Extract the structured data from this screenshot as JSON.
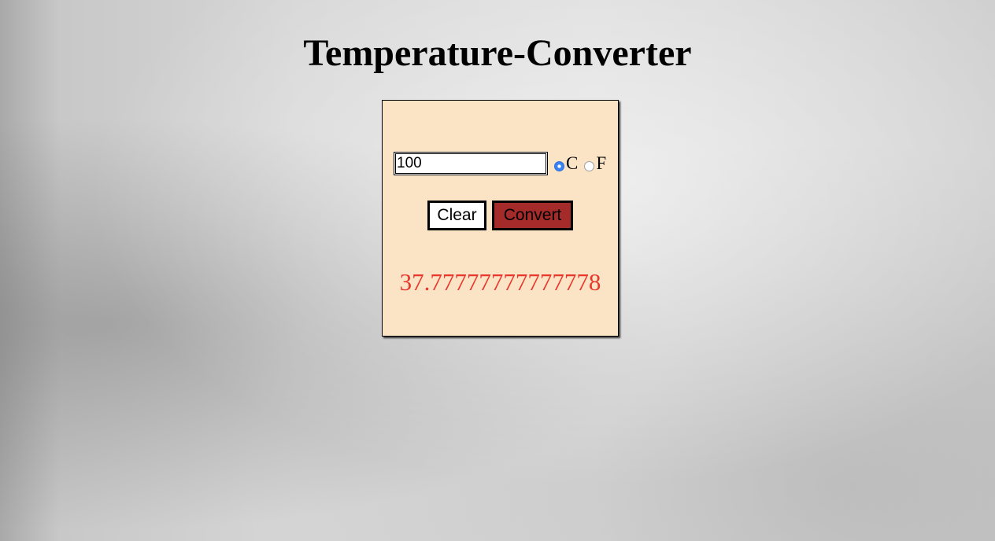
{
  "page": {
    "title": "Temperature-Converter"
  },
  "converter": {
    "input_value": "100",
    "units": {
      "celsius_label": "C",
      "fahrenheit_label": "F",
      "selected": "C"
    },
    "clear_label": "Clear",
    "convert_label": "Convert",
    "result": "37.77777777777778"
  },
  "colors": {
    "panel_background": "#fbe4c6",
    "convert_button": "#a52a2a",
    "result_text": "#e8372c",
    "radio_selected": "#3b82f6"
  }
}
